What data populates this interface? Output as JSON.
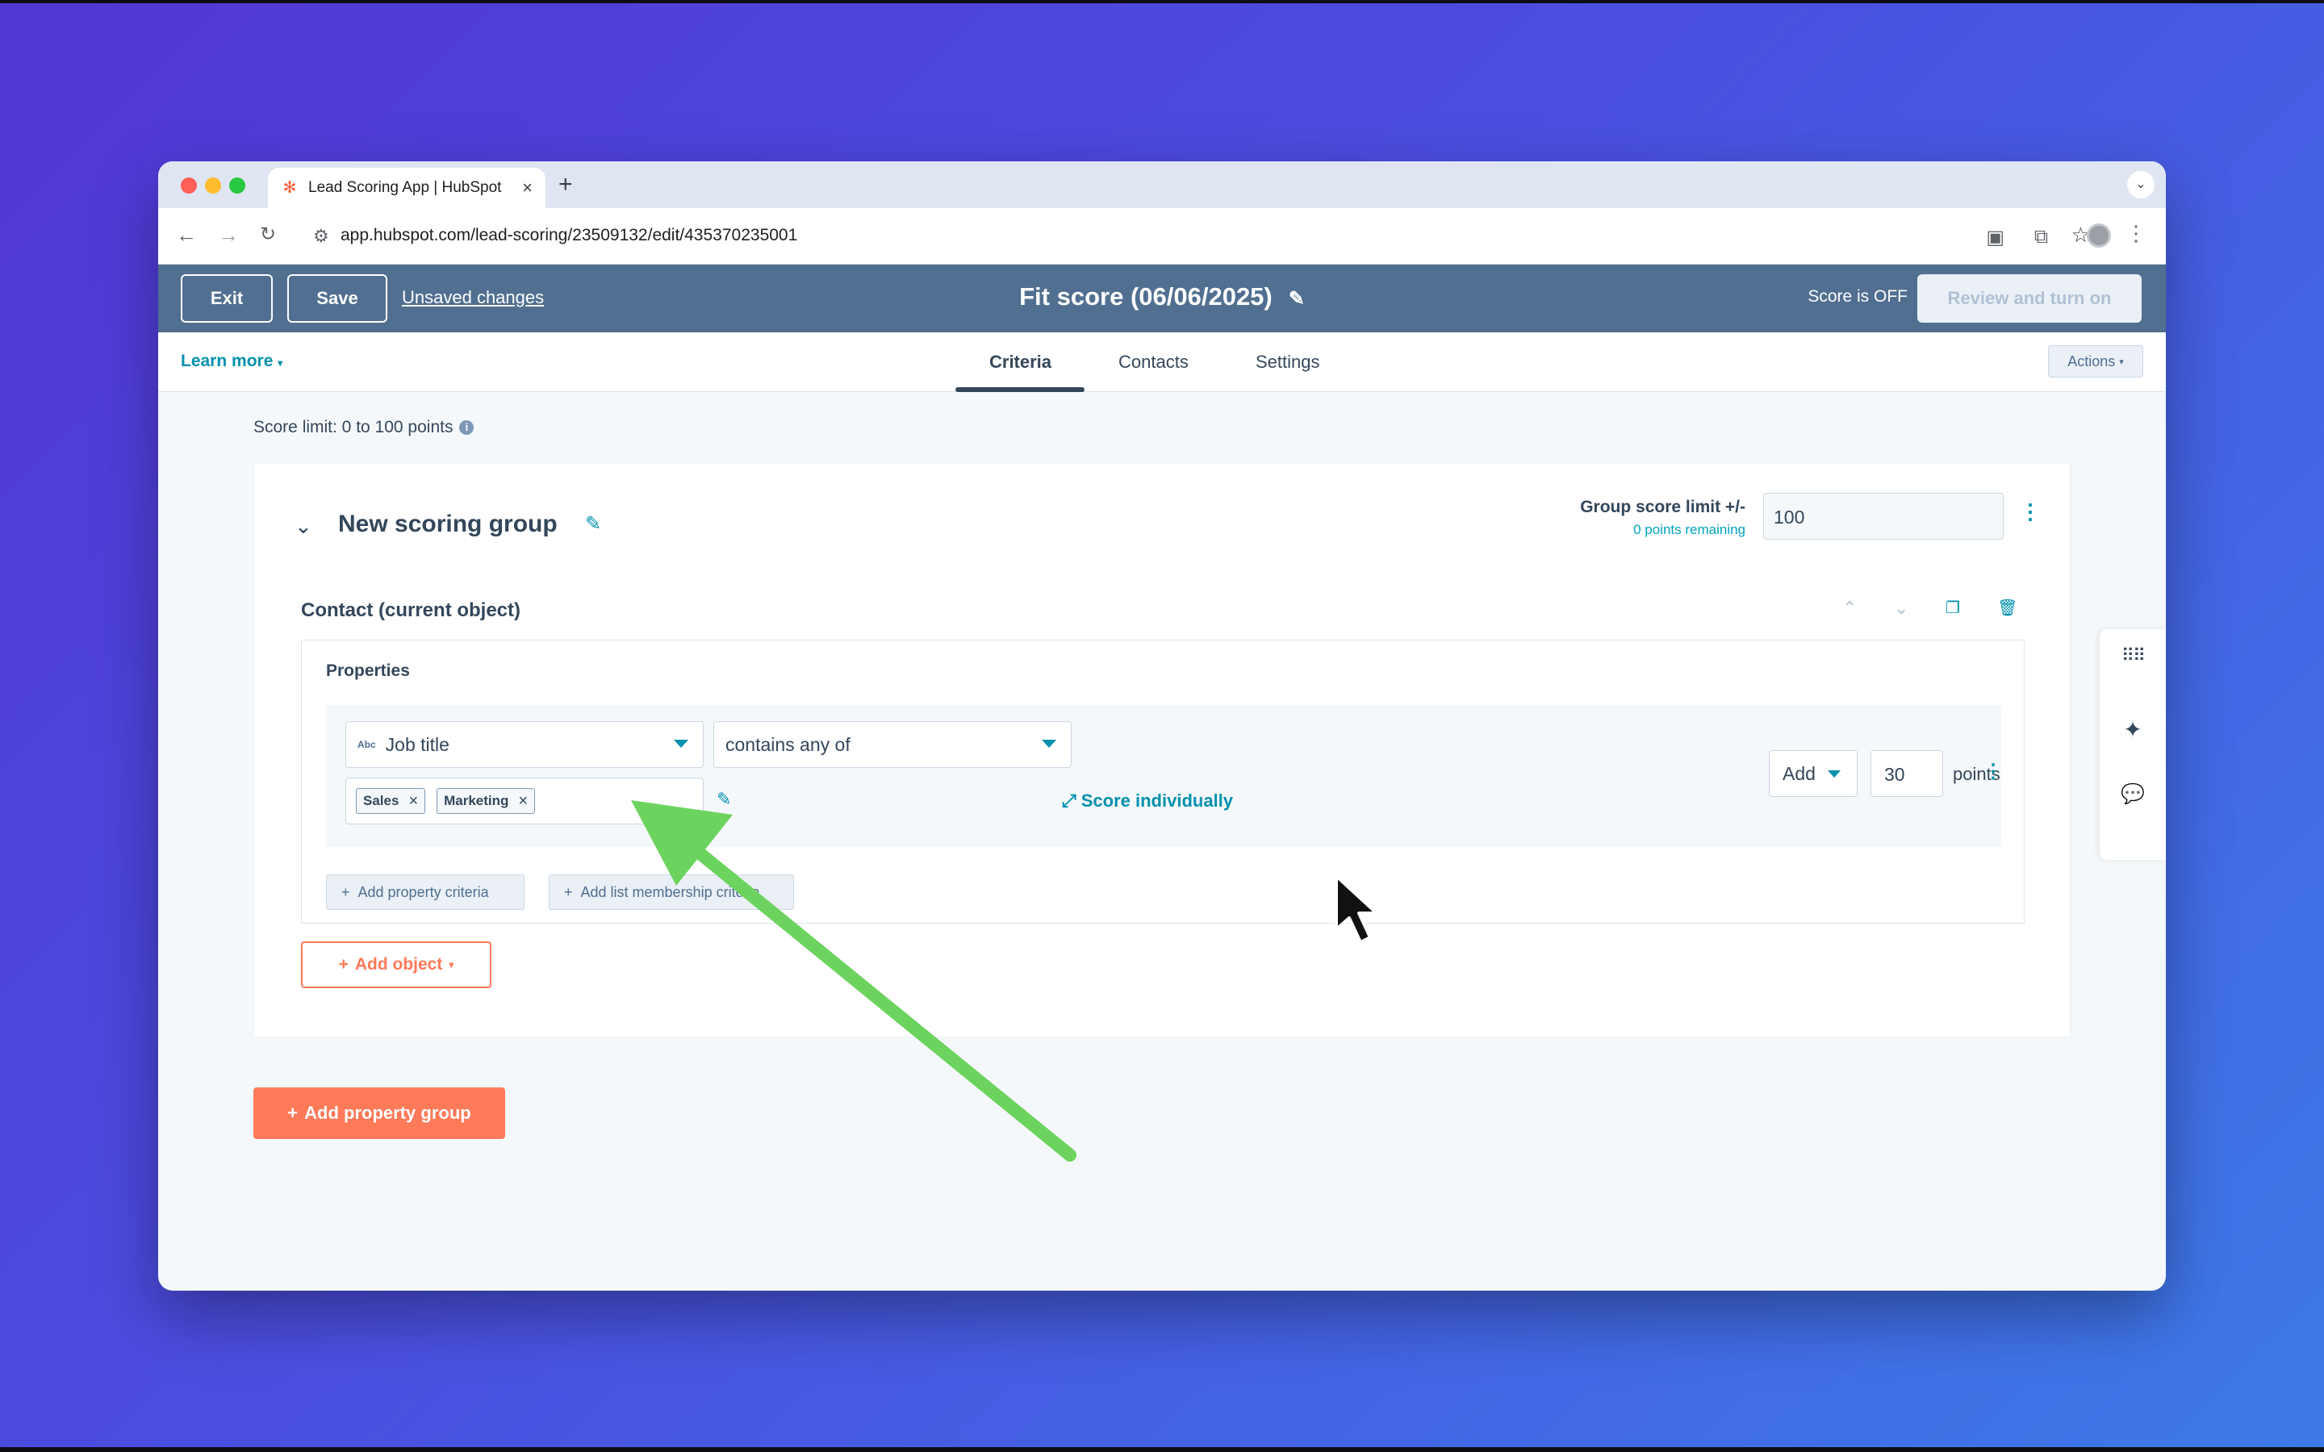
{
  "browser": {
    "tab_title": "Lead Scoring App | HubSpot",
    "url": "app.hubspot.com/lead-scoring/23509132/edit/435370235001"
  },
  "header": {
    "exit_label": "Exit",
    "save_label": "Save",
    "unsaved_label": "Unsaved changes",
    "title": "Fit score (06/06/2025)",
    "status_text": "Score is OFF",
    "review_label": "Review and turn on"
  },
  "subnav": {
    "learn_more": "Learn more",
    "tabs": [
      "Criteria",
      "Contacts",
      "Settings"
    ],
    "active_tab": "Criteria",
    "actions_label": "Actions"
  },
  "score_limit": "Score limit: 0 to 100 points",
  "group": {
    "title": "New scoring group",
    "limit_label": "Group score limit +/-",
    "remaining": "0 points remaining",
    "limit_value": "100",
    "object_title": "Contact (current object)",
    "properties_title": "Properties",
    "criteria": {
      "property": "Job title",
      "property_type": "Abc",
      "operator": "contains any of",
      "values": [
        "Sales",
        "Marketing"
      ],
      "score_individually": "Score individually",
      "action": "Add",
      "points": "30",
      "points_label": "points"
    },
    "add_property_criteria": "Add property criteria",
    "add_list_criteria": "Add list membership criteria",
    "add_object": "Add object"
  },
  "add_property_group": "Add property group",
  "colors": {
    "header_bg": "#516f90",
    "accent_teal": "#0091ae",
    "accent_orange": "#ff7a59",
    "annotation_arrow": "#6dd35f"
  }
}
